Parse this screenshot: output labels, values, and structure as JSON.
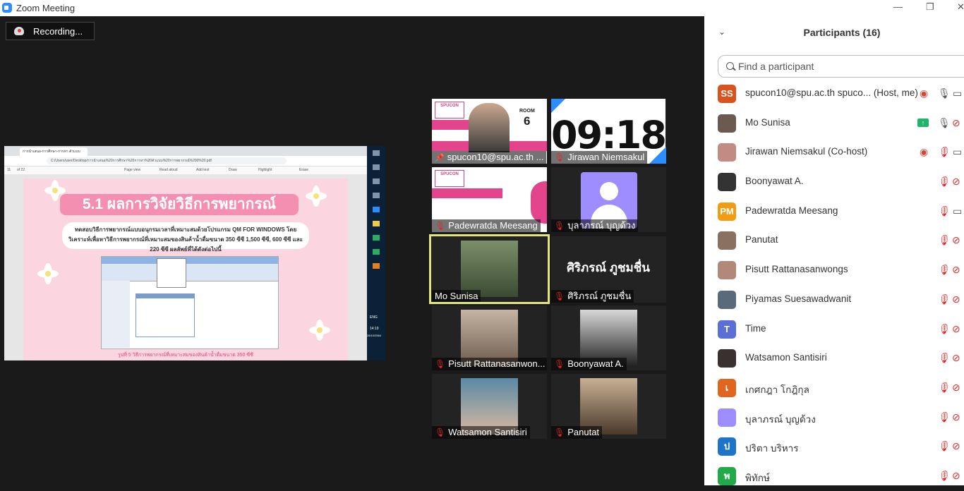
{
  "window": {
    "title": "Zoom Meeting"
  },
  "recording": {
    "label": "Recording..."
  },
  "shared_screen": {
    "browser_tab": "การนำเสนอ-การศึกษา-การหา ตัวแบบ",
    "url": "C:/Users/user/Desktop/การนำเสนอ%20การศึกษา%20การหา%20ตัวแบบ%20การพยากรณ์%200%20.pdf",
    "pdf_toolbar": [
      "Page view",
      "Read aloud",
      "Add text",
      "Draw",
      "Highlight",
      "Erase"
    ],
    "page_number": "11",
    "page_total": "of 22",
    "slide_title": "5.1 ผลการวิจัยวิธีการพยากรณ์",
    "slide_description": "ทดสอบวิธีการพยากรณ์แบบอนุกรมเวลาที่เหมาะสมด้วยโปรแกรม QM FOR WINDOWS โดยวิเคราะห์เพื่อหาวิธีการพยากรณ์ที่เหมาะสมของสินค้าน้ำดื่มขนาด 350 ซีซี 1,500 ซีซี, 600 ซีซี และ 220 ซีซี ผลลัพธ์ที่ได้ดังต่อไปนี้",
    "slide_caption": "รูปที่ 5 วิธีการพยากรณ์ที่เหมาะสมของสินค้าน้ำดื่มขนาด 350 ซีซี",
    "taskbar_time": "14:19",
    "taskbar_date": "28/10/2564",
    "taskbar_lang": "ENG"
  },
  "gallery": [
    {
      "name": "spucon10@spu.ac.th ...",
      "muted": false,
      "pinned": true,
      "kind": "presenter"
    },
    {
      "name": "Jirawan Niemsakul",
      "muted": true,
      "kind": "clock",
      "clock": "09:18"
    },
    {
      "name": "Padewratda Meesang",
      "muted": true,
      "kind": "slide"
    },
    {
      "name": "บุลาภรณ์ บุญด้วง",
      "muted": true,
      "kind": "avatar"
    },
    {
      "name": "Mo Sunisa",
      "muted": false,
      "kind": "photo",
      "active": true
    },
    {
      "name": "ศิริภรณ์ ภูชมชื่น",
      "muted": true,
      "kind": "text",
      "card_text": "ศิริภรณ์ ภูชมชื่น"
    },
    {
      "name": "Pisutt Rattanasanwon...",
      "muted": true,
      "kind": "photo"
    },
    {
      "name": "Boonyawat A.",
      "muted": true,
      "kind": "photo"
    },
    {
      "name": "Watsamon Santisiri",
      "muted": true,
      "kind": "photo"
    },
    {
      "name": "Panutat",
      "muted": true,
      "kind": "photo"
    }
  ],
  "tile_room": {
    "label": "ROOM",
    "number": "6"
  },
  "participants_panel": {
    "title": "Participants (16)",
    "search_placeholder": "Find a participant",
    "participants": [
      {
        "initials": "SS",
        "color": "#d9531e",
        "name": "spucon10@spu.ac.th spuco...  (Host, me)",
        "rec": true,
        "mic": "on",
        "cam": "on"
      },
      {
        "initials": "",
        "color": "#6b5a4f",
        "name": "Mo Sunisa",
        "share": true,
        "mic": "on",
        "cam": "off"
      },
      {
        "initials": "",
        "color": "#c28b83",
        "name": "Jirawan Niemsakul (Co-host)",
        "rec": true,
        "mic": "off",
        "cam": "on"
      },
      {
        "initials": "",
        "color": "#333333",
        "name": "Boonyawat A.",
        "mic": "off",
        "cam": "off"
      },
      {
        "initials": "PM",
        "color": "#f29c12",
        "name": "Padewratda Meesang",
        "mic": "off",
        "cam": "on"
      },
      {
        "initials": "",
        "color": "#8a7060",
        "name": "Panutat",
        "mic": "off",
        "cam": "off"
      },
      {
        "initials": "",
        "color": "#b0897a",
        "name": "Pisutt Rattanasanwongs",
        "mic": "off",
        "cam": "off"
      },
      {
        "initials": "",
        "color": "#5a6a7a",
        "name": "Piyamas Suesawadwanit",
        "mic": "off",
        "cam": "off"
      },
      {
        "initials": "T",
        "color": "#5b6fd6",
        "name": "Time",
        "mic": "off",
        "cam": "off"
      },
      {
        "initials": "",
        "color": "#3a3030",
        "name": "Watsamon Santisiri",
        "mic": "off",
        "cam": "off"
      },
      {
        "initials": "เ",
        "color": "#e0661f",
        "name": "เกศกฎา โกฎิกุล",
        "mic": "off",
        "cam": "off"
      },
      {
        "initials": "",
        "color": "#9d8dff",
        "name": "บุลาภรณ์ บุญด้วง",
        "mic": "off",
        "cam": "off"
      },
      {
        "initials": "ป",
        "color": "#1e74c6",
        "name": "ปริตา บริหาร",
        "mic": "off",
        "cam": "off"
      },
      {
        "initials": "พ",
        "color": "#22a94a",
        "name": "พิทักษ์",
        "mic": "off",
        "cam": "off"
      }
    ]
  },
  "colors": {
    "mute": "#e02828",
    "active_speaker": "#e2e67e",
    "accent": "#2d8cff"
  }
}
